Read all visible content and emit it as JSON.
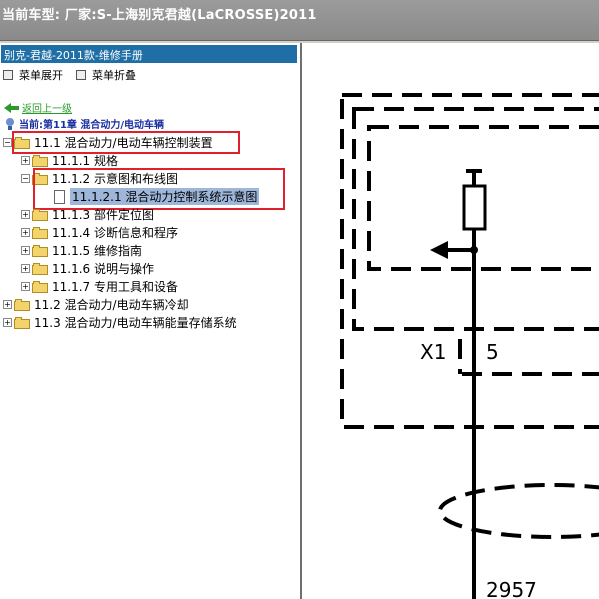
{
  "title_bar": {
    "text": "当前车型:  厂家:S-上海别克君越(LaCROSSE)2011"
  },
  "left_panel": {
    "header": "别克-君越-2011款-维修手册",
    "toolbar": {
      "expand_label": "菜单展开",
      "collapse_label": "菜单折叠"
    },
    "back_link": "返回上一级",
    "current_chapter": "当前:第11章 混合动力/电动车辆",
    "tree": [
      {
        "label": "11.1 混合动力/电动车辆控制装置"
      },
      {
        "label": "11.1.1 规格"
      },
      {
        "label": "11.1.2 示意图和布线图"
      },
      {
        "label": "11.1.2.1 混合动力控制系统示意图"
      },
      {
        "label": "11.1.3 部件定位图"
      },
      {
        "label": "11.1.4 诊断信息和程序"
      },
      {
        "label": "11.1.5 维修指南"
      },
      {
        "label": "11.1.6 说明与操作"
      },
      {
        "label": "11.1.7 专用工具和设备"
      },
      {
        "label": "11.2 混合动力/电动车辆冷却"
      },
      {
        "label": "11.3 混合动力/电动车辆能量存储系统"
      }
    ]
  },
  "diagram": {
    "connector_label": "X1",
    "pin_label": "5",
    "wire_code": "2957"
  }
}
